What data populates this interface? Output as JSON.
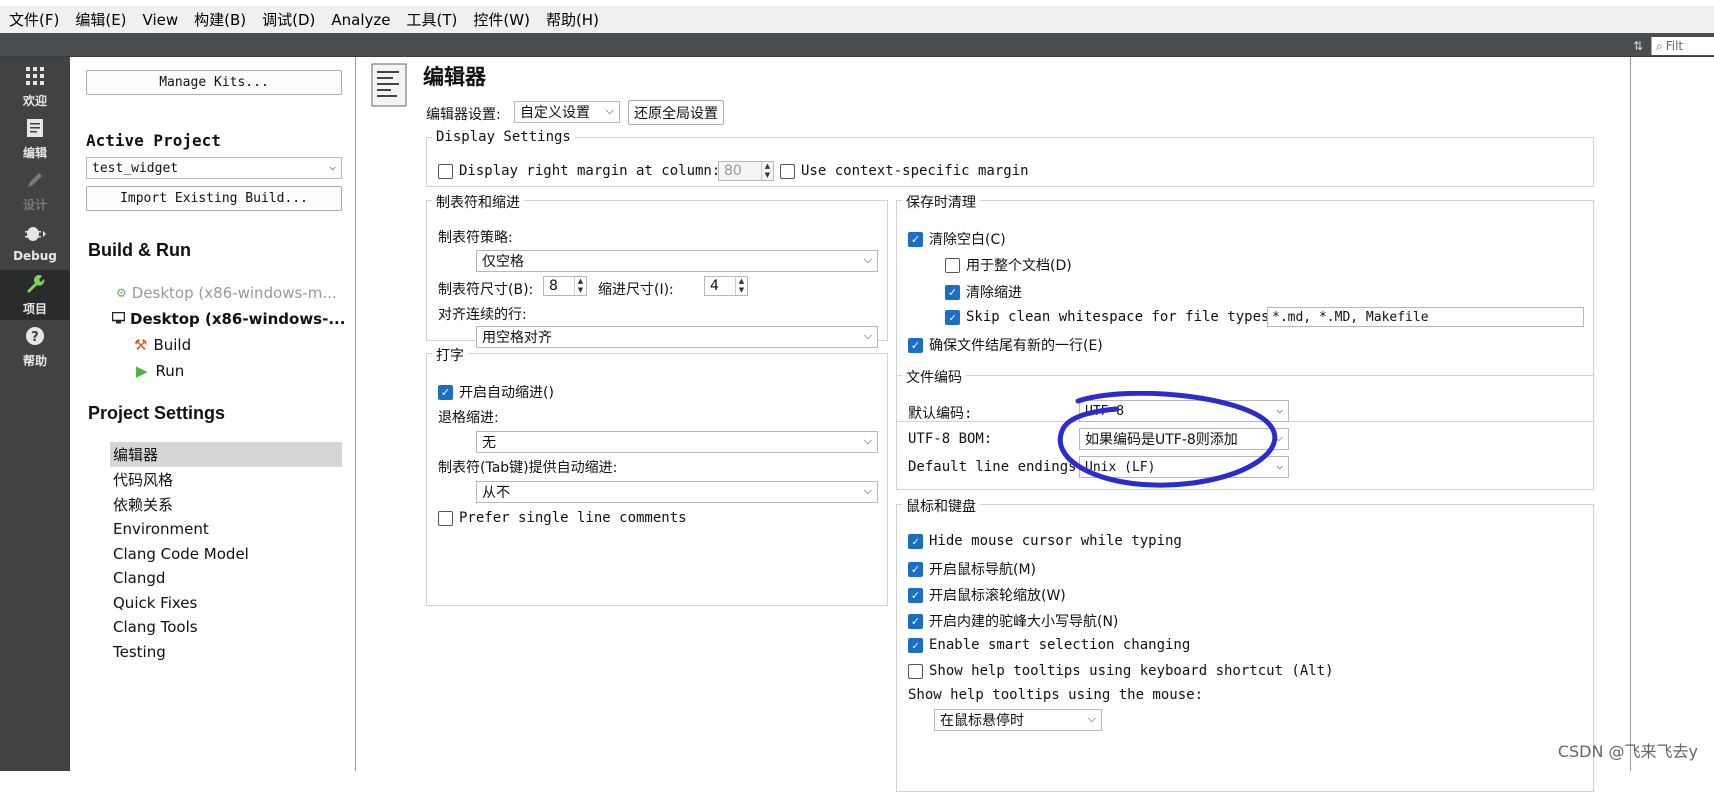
{
  "menubar": [
    "文件(F)",
    "编辑(E)",
    "View",
    "构建(B)",
    "调试(D)",
    "Analyze",
    "工具(T)",
    "控件(W)",
    "帮助(H)"
  ],
  "toolbar": {
    "filter_placeholder": "Filt"
  },
  "modes": [
    {
      "label": "欢迎",
      "icon": "grid-icon",
      "state": "normal"
    },
    {
      "label": "编辑",
      "icon": "document-icon",
      "state": "normal"
    },
    {
      "label": "设计",
      "icon": "pencil-icon",
      "state": "disabled"
    },
    {
      "label": "Debug",
      "icon": "bug-icon",
      "state": "normal"
    },
    {
      "label": "项目",
      "icon": "wrench-icon",
      "state": "active"
    },
    {
      "label": "帮助",
      "icon": "help-icon",
      "state": "normal"
    }
  ],
  "project_pane": {
    "manage_kits": "Manage Kits...",
    "active_project_heading": "Active Project",
    "active_project": "test_widget",
    "import_build": "Import Existing Build...",
    "build_run_heading": "Build & Run",
    "kits": [
      {
        "label": "Desktop (x86-windows-m...",
        "enabled": false
      },
      {
        "label": "Desktop (x86-windows-...",
        "enabled": true
      }
    ],
    "build": "Build",
    "run": "Run",
    "project_settings_heading": "Project Settings",
    "settings_items": [
      "编辑器",
      "代码风格",
      "依赖关系",
      "Environment",
      "Clang Code Model",
      "Clangd",
      "Quick Fixes",
      "Clang Tools",
      "Testing"
    ],
    "selected_settings_index": 0
  },
  "editor": {
    "title": "编辑器",
    "settings_label": "编辑器设置:",
    "settings_value": "自定义设置",
    "restore_button": "还原全局设置",
    "display": {
      "title": "Display Settings",
      "right_margin_label": "Display right margin at column:",
      "right_margin_value": "80",
      "right_margin_checked": false,
      "context_margin_label": "Use context-specific margin",
      "context_margin_checked": false
    },
    "tabs": {
      "title": "制表符和缩进",
      "policy_label": "制表符策略:",
      "policy_value": "仅空格",
      "tab_size_label": "制表符尺寸(B):",
      "tab_size": "8",
      "indent_size_label": "缩进尺寸(I):",
      "indent_size": "4",
      "align_label": "对齐连续的行:",
      "align_value": "用空格对齐"
    },
    "typing": {
      "title": "打字",
      "auto_indent_label": "开启自动缩进()",
      "auto_indent_checked": true,
      "backspace_label": "退格缩进:",
      "backspace_value": "无",
      "tab_indent_label": "制表符(Tab键)提供自动缩进:",
      "tab_indent_value": "从不",
      "single_line_label": "Prefer single line comments",
      "single_line_checked": false
    },
    "save_cleanup": {
      "title": "保存时清理",
      "clean_whitespace": "清除空白(C)",
      "clean_whitespace_checked": true,
      "whole_document": "用于整个文档(D)",
      "whole_document_checked": false,
      "clean_indent": "清除缩进",
      "clean_indent_checked": true,
      "skip_clean": "Skip clean whitespace for file types:",
      "skip_clean_checked": true,
      "skip_types": "*.md, *.MD, Makefile",
      "newline_end": "确保文件结尾有新的一行(E)",
      "newline_end_checked": true
    },
    "encoding": {
      "title": "文件编码",
      "default_label": "默认编码:",
      "default_value": "UTF-8",
      "bom_label": "UTF-8 BOM:",
      "bom_value": "如果编码是UTF-8则添加",
      "line_endings_label": "Default line endings:",
      "line_endings_value": "Unix (LF)"
    },
    "mouse_keyboard": {
      "title": "鼠标和键盘",
      "items": [
        {
          "label": "Hide mouse cursor while typing",
          "checked": true
        },
        {
          "label": "开启鼠标导航(M)",
          "checked": true
        },
        {
          "label": "开启鼠标滚轮缩放(W)",
          "checked": true
        },
        {
          "label": "开启内建的驼峰大小写导航(N)",
          "checked": true
        },
        {
          "label": "Enable smart selection changing",
          "checked": true
        },
        {
          "label": "Show help tooltips using keyboard shortcut (Alt)",
          "checked": false
        }
      ],
      "tooltips_label": "Show help tooltips using the mouse:",
      "tooltips_value": "在鼠标悬停时"
    }
  },
  "annotation_color": "#2b2bd0",
  "watermark": "CSDN @飞来飞去y"
}
